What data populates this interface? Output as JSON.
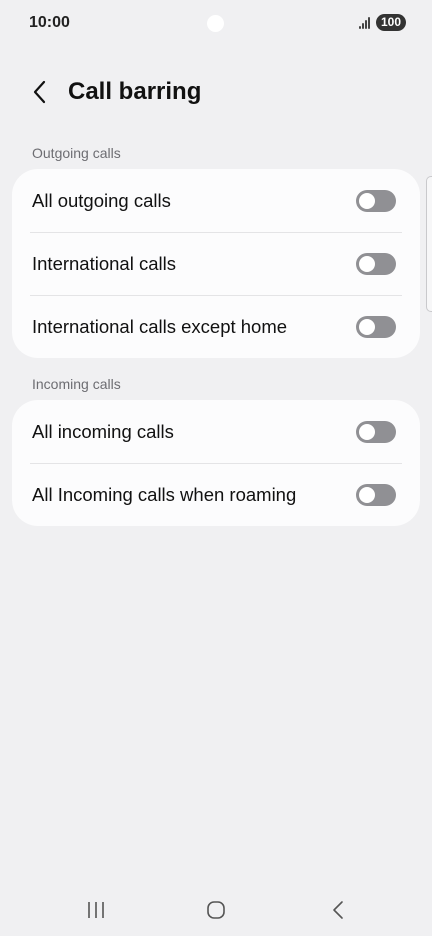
{
  "status_bar": {
    "time": "10:00",
    "battery": "100",
    "icons": [
      "signal-icon",
      "battery-icon"
    ]
  },
  "header": {
    "title": "Call barring",
    "back_icon": "chevron-left-icon"
  },
  "sections": [
    {
      "label": "Outgoing calls",
      "items": [
        {
          "label": "All outgoing calls",
          "enabled": false
        },
        {
          "label": "International calls",
          "enabled": false
        },
        {
          "label": "International calls except home",
          "enabled": false
        }
      ]
    },
    {
      "label": "Incoming calls",
      "items": [
        {
          "label": "All incoming calls",
          "enabled": false
        },
        {
          "label": "All Incoming calls when roaming",
          "enabled": false
        }
      ]
    }
  ],
  "nav_bar": {
    "icons": [
      "recent-apps-icon",
      "home-icon",
      "back-icon"
    ]
  },
  "colors": {
    "background": "#f0f0f2",
    "card": "#fcfcfd",
    "toggle_off": "#909094",
    "section_label": "#6d6d72"
  }
}
